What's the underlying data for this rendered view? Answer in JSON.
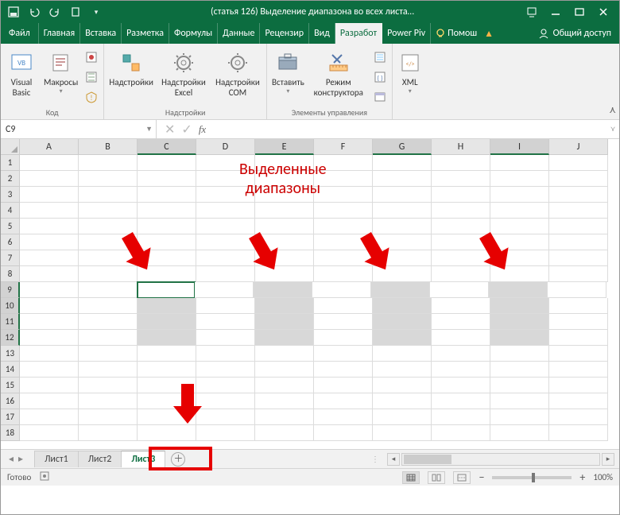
{
  "app": {
    "title": "(статья 126) Выделение диапазона во всех листа…"
  },
  "tabs": {
    "file": "Файл",
    "items": [
      "Главная",
      "Вставка",
      "Разметка",
      "Формулы",
      "Данные",
      "Рецензир",
      "Вид",
      "Разработ",
      "Power Piv"
    ],
    "active_index": 7,
    "help": "Помош",
    "share": "Общий доступ"
  },
  "ribbon": {
    "groups": [
      {
        "label": "Код",
        "items": [
          "Visual Basic",
          "Макросы"
        ]
      },
      {
        "label": "Надстройки",
        "items": [
          "Надстройки",
          "Надстройки Excel",
          "Надстройки COM"
        ]
      },
      {
        "label": "Элементы управления",
        "items": [
          "Вставить",
          "Режим конструктора"
        ]
      },
      {
        "label": "",
        "items": [
          "XML"
        ]
      }
    ]
  },
  "namebox": "C9",
  "grid": {
    "columns": [
      "A",
      "B",
      "C",
      "D",
      "E",
      "F",
      "G",
      "H",
      "I",
      "J"
    ],
    "rows": [
      1,
      2,
      3,
      4,
      5,
      6,
      7,
      8,
      9,
      10,
      11,
      12,
      13,
      14,
      15,
      16,
      17,
      18
    ],
    "active_cell": "C9",
    "selected_cols": [
      "C",
      "E",
      "G",
      "I"
    ],
    "selected_rows": [
      9,
      10,
      11,
      12
    ]
  },
  "annotation": {
    "line1": "Выделенные",
    "line2": "диапазоны"
  },
  "sheets": {
    "items": [
      "Лист1",
      "Лист2",
      "Лист3"
    ],
    "active_index": 2
  },
  "status": {
    "ready": "Готово",
    "zoom_pct": "100%"
  }
}
